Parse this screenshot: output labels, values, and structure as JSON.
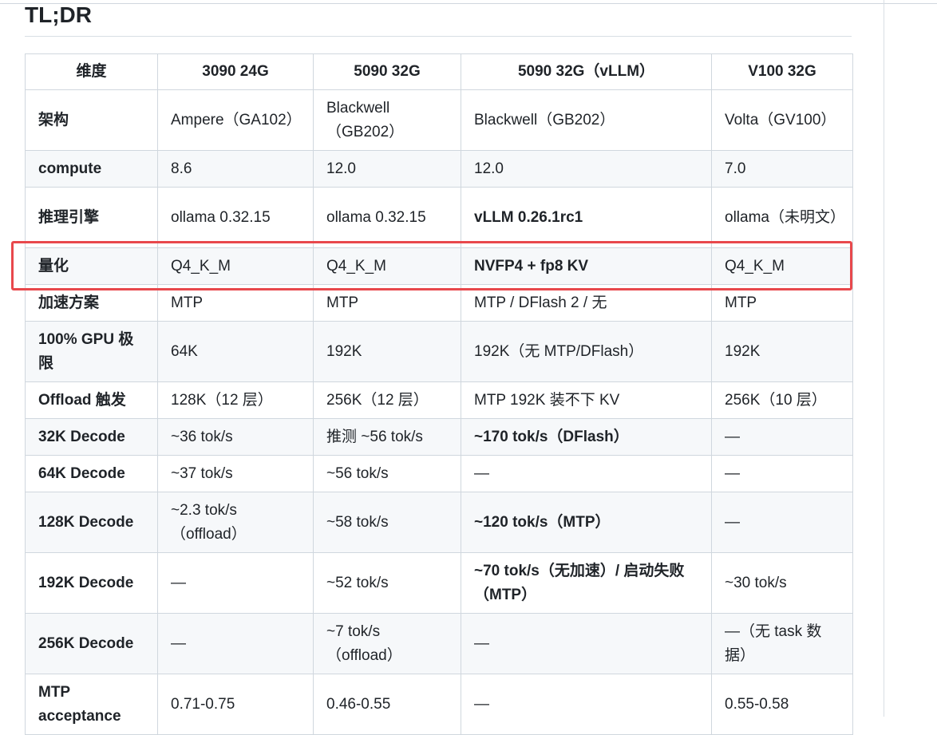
{
  "page": {
    "title": "TL;DR"
  },
  "table": {
    "headers": [
      "维度",
      "3090 24G",
      "5090 32G",
      "5090 32G（vLLM）",
      "V100 32G"
    ],
    "rows": [
      [
        "架构",
        "Ampere（GA102）",
        "Blackwell（GB202）",
        "Blackwell（GB202）",
        "Volta（GV100）"
      ],
      [
        "compute",
        "8.6",
        "12.0",
        "12.0",
        "7.0"
      ],
      [
        "推理引擎",
        "ollama 0.32.15",
        "ollama 0.32.15",
        "vLLM 0.26.1rc1",
        "ollama（未明文）"
      ],
      [
        "量化",
        "Q4_K_M",
        "Q4_K_M",
        "NVFP4 + fp8 KV",
        "Q4_K_M"
      ],
      [
        "加速方案",
        "MTP",
        "MTP",
        "MTP / DFlash 2 / 无",
        "MTP"
      ],
      [
        "100% GPU 极限",
        "64K",
        "192K",
        "192K（无 MTP/DFlash）",
        "192K"
      ],
      [
        "Offload 触发",
        "128K（12 层）",
        "256K（12 层）",
        "MTP 192K 装不下 KV",
        "256K（10 层）"
      ],
      [
        "32K Decode",
        "~36 tok/s",
        "推测 ~56 tok/s",
        "~170 tok/s（DFlash）",
        "—"
      ],
      [
        "64K Decode",
        "~37 tok/s",
        "~56 tok/s",
        "—",
        "—"
      ],
      [
        "128K Decode",
        "~2.3 tok/s（offload）",
        "~58 tok/s",
        "~120 tok/s（MTP）",
        "—"
      ],
      [
        "192K Decode",
        "—",
        "~52 tok/s",
        "~70 tok/s（无加速）/ 启动失败（MTP）",
        "~30 tok/s"
      ],
      [
        "256K Decode",
        "—",
        "~7 tok/s（offload）",
        "—",
        "—（无 task 数据）"
      ],
      [
        "MTP acceptance",
        "0.71-0.75",
        "0.46-0.55",
        "—",
        "0.55-0.58"
      ]
    ]
  }
}
